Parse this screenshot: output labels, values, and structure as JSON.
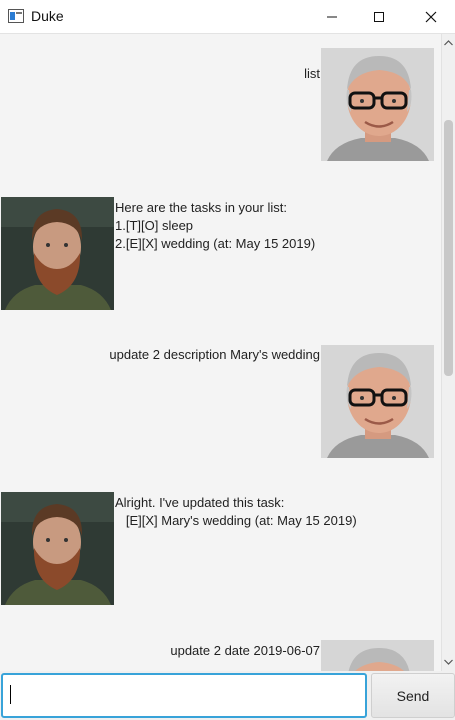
{
  "window": {
    "title": "Duke"
  },
  "messages": [
    {
      "sender": "user",
      "text": "list"
    },
    {
      "sender": "bot",
      "text": "Here are the tasks in your list:\n1.[T][O] sleep\n2.[E][X] wedding (at: May 15 2019)"
    },
    {
      "sender": "user",
      "text": "update 2 description Mary's wedding"
    },
    {
      "sender": "bot",
      "text": "Alright. I've updated this task:\n   [E][X] Mary's wedding (at: May 15 2019)"
    },
    {
      "sender": "user",
      "text": "update 2 date 2019-06-07"
    }
  ],
  "input": {
    "value": "",
    "placeholder": ""
  },
  "send_label": "Send",
  "colors": {
    "focus_border": "#38a3d9",
    "background": "#f4f4f4"
  },
  "icons": {
    "user_avatar": "user-avatar",
    "bot_avatar": "bot-avatar"
  }
}
